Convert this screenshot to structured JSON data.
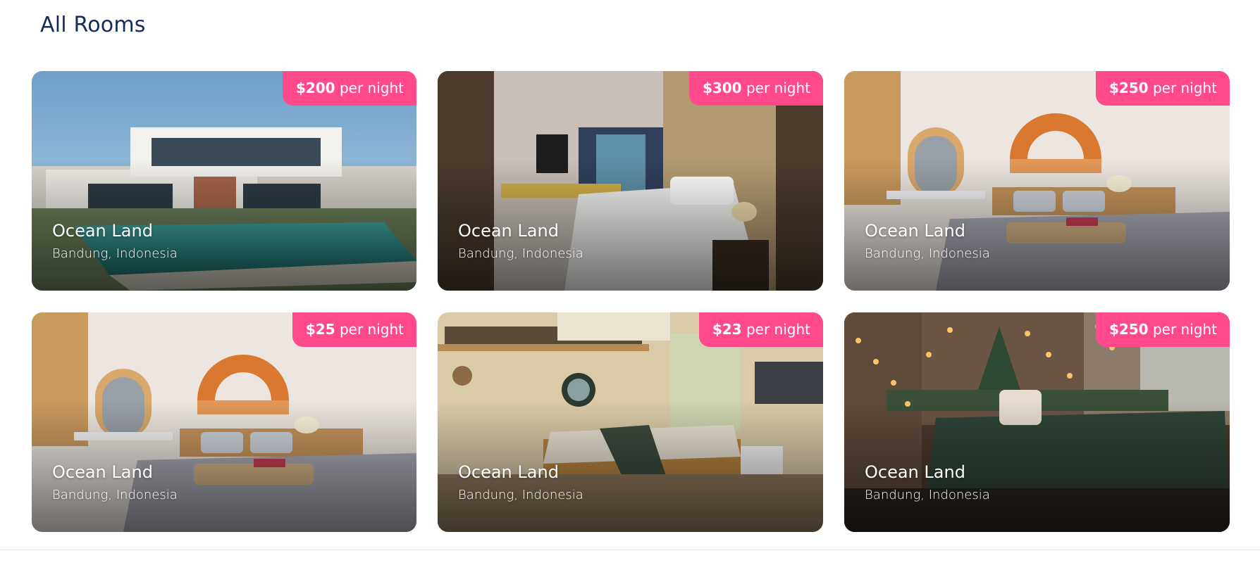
{
  "section": {
    "title": "All Rooms"
  },
  "rooms": [
    {
      "name": "Ocean Land",
      "location": "Bandung, Indonesia",
      "price": "$200",
      "price_suffix": "per night",
      "photo_icon": "villa-pool-photo"
    },
    {
      "name": "Ocean Land",
      "location": "Bandung, Indonesia",
      "price": "$300",
      "price_suffix": "per night",
      "photo_icon": "hotel-bedroom-photo"
    },
    {
      "name": "Ocean Land",
      "location": "Bandung, Indonesia",
      "price": "$250",
      "price_suffix": "per night",
      "photo_icon": "macrame-bedroom-photo"
    },
    {
      "name": "Ocean Land",
      "location": "Bandung, Indonesia",
      "price": "$25",
      "price_suffix": "per night",
      "photo_icon": "macrame-bedroom-photo"
    },
    {
      "name": "Ocean Land",
      "location": "Bandung, Indonesia",
      "price": "$23",
      "price_suffix": "per night",
      "photo_icon": "cozy-bedroom-photo"
    },
    {
      "name": "Ocean Land",
      "location": "Bandung, Indonesia",
      "price": "$250",
      "price_suffix": "per night",
      "photo_icon": "loft-bedroom-photo"
    }
  ],
  "colors": {
    "title": "#152C5B",
    "price_badge": "#FF498B",
    "card_text": "#FFFFFF"
  }
}
